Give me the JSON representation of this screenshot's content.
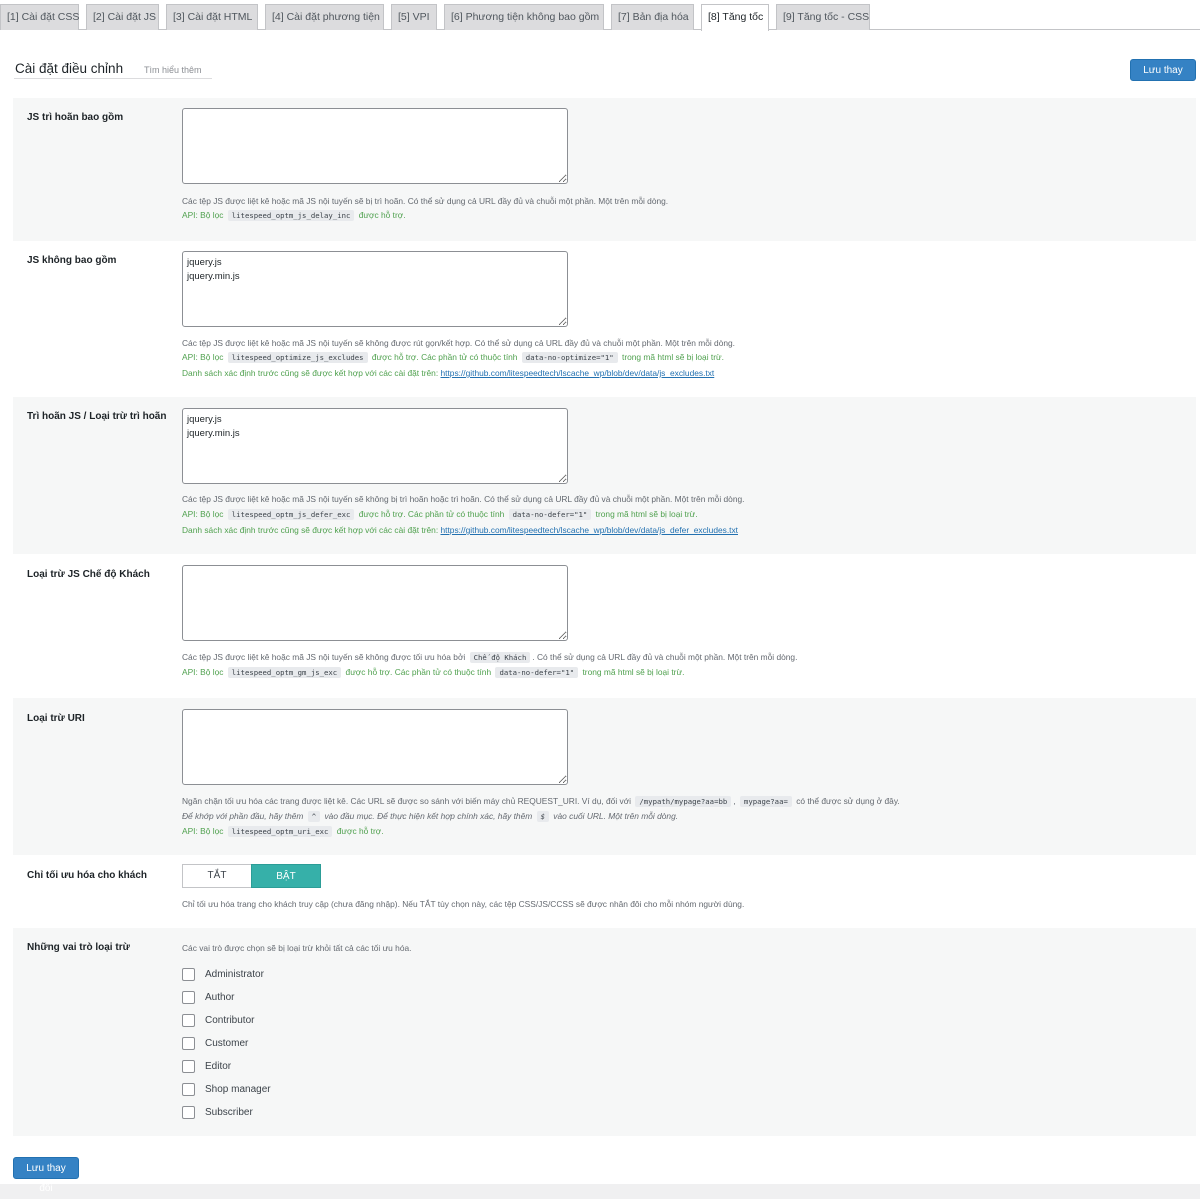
{
  "tabs": [
    {
      "label": "[1] Cài đặt CSS"
    },
    {
      "label": "[2] Cài đặt JS"
    },
    {
      "label": "[3] Cài đặt HTML"
    },
    {
      "label": "[4] Cài đặt phương tiện"
    },
    {
      "label": "[5] VPI"
    },
    {
      "label": "[6] Phương tiện không bao gồm"
    },
    {
      "label": "[7] Bản địa hóa"
    },
    {
      "label": "[8] Tăng tốc"
    },
    {
      "label": "[9] Tăng tốc - CSS"
    }
  ],
  "header": {
    "title": "Cài đặt điều chỉnh",
    "learn_more": "Tìm hiểu thêm",
    "save_label": "Lưu thay đổi"
  },
  "sections": {
    "js_delay_include": {
      "label": "JS trì hoãn bao gồm",
      "value": "",
      "desc1": "Các tệp JS được liệt kê hoặc mã JS nội tuyến sẽ bị trì hoãn. Có thể sử dụng cả URL đầy đủ và chuỗi một phần. Một trên mỗi dòng.",
      "api_prefix": "API: Bộ lọc",
      "api_code": "litespeed_optm_js_delay_inc",
      "api_suffix": "được hỗ trợ."
    },
    "js_exclude": {
      "label": "JS không bao gồm",
      "value": "jquery.js\njquery.min.js",
      "desc1": "Các tệp JS được liệt kê hoặc mã JS nội tuyến sẽ không được rút gọn/kết hợp. Có thể sử dụng cả URL đầy đủ và chuỗi một phần. Một trên mỗi dòng.",
      "api_prefix": "API: Bộ lọc",
      "api_code": "litespeed_optimize_js_excludes",
      "api_mid": "được hỗ trợ. Các phần tử có thuộc tính",
      "api_code2": "data-no-optimize=\"1\"",
      "api_suffix": "trong mã html sẽ bị loại trừ.",
      "predef_text": "Danh sách xác định trước cũng sẽ được kết hợp với các cài đặt trên:",
      "predef_link": "https://github.com/litespeedtech/lscache_wp/blob/dev/data/js_excludes.txt"
    },
    "js_defer_exclude": {
      "label": "Trì hoãn JS / Loại trừ trì hoãn",
      "value": "jquery.js\njquery.min.js",
      "desc1": "Các tệp JS được liệt kê hoặc mã JS nội tuyến sẽ không bị trì hoãn hoặc trì hoãn. Có thể sử dụng cả URL đầy đủ và chuỗi một phần. Một trên mỗi dòng.",
      "api_prefix": "API: Bộ lọc",
      "api_code": "litespeed_optm_js_defer_exc",
      "api_mid": "được hỗ trợ. Các phần tử có thuộc tính",
      "api_code2": "data-no-defer=\"1\"",
      "api_suffix": "trong mã html sẽ bị loại trừ.",
      "predef_text": "Danh sách xác định trước cũng sẽ được kết hợp với các cài đặt trên:",
      "predef_link": "https://github.com/litespeedtech/lscache_wp/blob/dev/data/js_defer_excludes.txt"
    },
    "js_guest_exclude": {
      "label": "Loại trừ JS Chế độ Khách",
      "value": "",
      "desc_prefix": "Các tệp JS được liệt kê hoặc mã JS nội tuyến sẽ không được tối ưu hóa bởi",
      "desc_code": "Chế độ Khách",
      "desc_suffix": ". Có thể sử dụng cả URL đầy đủ và chuỗi một phần. Một trên mỗi dòng.",
      "api_prefix": "API: Bộ lọc",
      "api_code": "litespeed_optm_gm_js_exc",
      "api_mid": "được hỗ trợ. Các phần tử có thuộc tính",
      "api_code2": "data-no-defer=\"1\"",
      "api_suffix": "trong mã html sẽ bị loại trừ."
    },
    "uri_exclude": {
      "label": "Loại trừ URI",
      "value": "",
      "desc_prefix": "Ngăn chặn tối ưu hóa các trang được liệt kê. Các URL sẽ được so sánh với biến máy chủ REQUEST_URI. Ví dụ, đối với",
      "desc_code1": "/mypath/mypage?aa=bb",
      "desc_sep": ",",
      "desc_code2": "mypage?aa=",
      "desc_suffix": "có thể được sử dụng ở đây.",
      "it_prefix": "Để khớp với phần đầu, hãy thêm",
      "it_code1": "^",
      "it_mid": "vào đầu mục. Để thực hiện kết hợp chính xác, hãy thêm",
      "it_code2": "$",
      "it_suffix": "vào cuối URL. Một trên mỗi dòng.",
      "api_prefix": "API: Bộ lọc",
      "api_code": "litespeed_optm_uri_exc",
      "api_suffix": "được hỗ trợ."
    },
    "guest_only": {
      "label": "Chỉ tối ưu hóa cho khách",
      "off_label": "TẮT",
      "on_label": "BẬT",
      "selected": "BẬT",
      "desc": "Chỉ tối ưu hóa trang cho khách truy cập (chưa đăng nhập). Nếu TẮT tùy chọn này, các tệp CSS/JS/CCSS sẽ được nhân đôi cho mỗi nhóm người dùng."
    },
    "role_exclude": {
      "label": "Những vai trò loại trừ",
      "desc": "Các vai trò được chọn sẽ bị loại trừ khỏi tất cả các tối ưu hóa.",
      "roles": [
        {
          "label": "Administrator",
          "checked": false
        },
        {
          "label": "Author",
          "checked": false
        },
        {
          "label": "Contributor",
          "checked": false
        },
        {
          "label": "Customer",
          "checked": false
        },
        {
          "label": "Editor",
          "checked": false
        },
        {
          "label": "Shop manager",
          "checked": false
        },
        {
          "label": "Subscriber",
          "checked": false
        }
      ]
    }
  },
  "colors": {
    "primary": "#3582c4",
    "toggle_on": "#36b0a9",
    "api_text": "#50a14f",
    "link": "#2271b1"
  }
}
